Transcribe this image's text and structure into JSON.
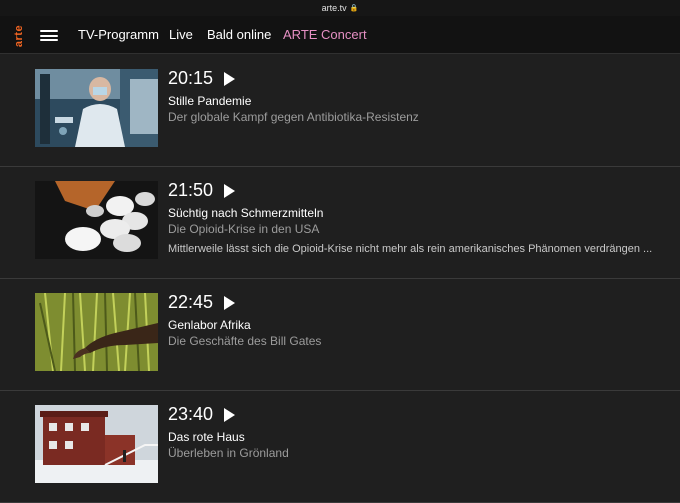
{
  "browser": {
    "url": "arte.tv"
  },
  "nav": {
    "logo": "arte",
    "links": [
      "TV-Programm",
      "Live",
      "Bald online",
      "ARTE Concert"
    ]
  },
  "program": [
    {
      "time": "20:15",
      "title": "Stille Pandemie",
      "subtitle": "Der globale Kampf gegen Antibiotika-Resistenz",
      "description": ""
    },
    {
      "time": "21:50",
      "title": "Süchtig nach Schmerzmitteln",
      "subtitle": "Die Opioid-Krise in den USA",
      "description": "Mittlerweile lässt sich die Opioid-Krise nicht mehr als rein amerikanisches Phänomen verdrängen ..."
    },
    {
      "time": "22:45",
      "title": "Genlabor Afrika",
      "subtitle": "Die Geschäfte des Bill Gates",
      "description": ""
    },
    {
      "time": "23:40",
      "title": "Das rote Haus",
      "subtitle": "Überleben in Grönland",
      "description": ""
    }
  ],
  "colors": {
    "background": "#1f1f1f",
    "nav_background": "#121212",
    "logo": "#f26522",
    "concert_link": "#e58fc3"
  },
  "icons": [
    "lock-icon",
    "hamburger-menu-icon",
    "play-icon"
  ]
}
